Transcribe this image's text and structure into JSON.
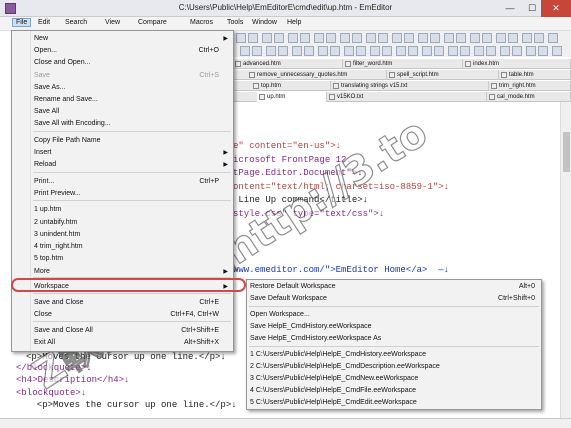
{
  "window": {
    "title": "C:\\Users\\Public\\Help\\EmEditorE\\cmd\\edit\\up.htm - EmEditor",
    "minimize_glyph": "—",
    "maximize_glyph": "☐",
    "close_glyph": "✕"
  },
  "menubar": [
    "File",
    "Edit",
    "Search",
    "View",
    "Compare",
    "Macros",
    "Tools",
    "Window",
    "Help"
  ],
  "tabs": {
    "row1": [
      "advanced.htm",
      "filter_word.htm",
      "index.htm"
    ],
    "row2": [
      "remove_unnecessary_quotes.htm",
      "spell_script.htm",
      "table.htm"
    ],
    "row3": [
      "top.htm",
      "translating strings v15.txt",
      "trim_right.htm"
    ],
    "row4": [
      "up.htm",
      "v15KO.txt",
      "cal_mode.htm"
    ]
  },
  "file_menu": {
    "items": [
      {
        "label": "New",
        "shortcut": "",
        "submenu": true,
        "disabled": false
      },
      {
        "label": "Open...",
        "shortcut": "Ctrl+O",
        "submenu": false,
        "disabled": false
      },
      {
        "label": "Close and Open...",
        "shortcut": "",
        "submenu": false,
        "disabled": false
      },
      {
        "label": "Save",
        "shortcut": "Ctrl+S",
        "submenu": false,
        "disabled": true
      },
      {
        "label": "Save As...",
        "shortcut": "",
        "submenu": false,
        "disabled": false
      },
      {
        "label": "Rename and Save...",
        "shortcut": "",
        "submenu": false,
        "disabled": false
      },
      {
        "label": "Save All",
        "shortcut": "",
        "submenu": false,
        "disabled": false
      },
      {
        "label": "Save All with Encoding...",
        "shortcut": "",
        "submenu": false,
        "disabled": false
      },
      {
        "label": "Copy File Path Name",
        "shortcut": "",
        "submenu": false,
        "disabled": false
      },
      {
        "label": "Insert",
        "shortcut": "",
        "submenu": true,
        "disabled": false
      },
      {
        "label": "Reload",
        "shortcut": "",
        "submenu": true,
        "disabled": false
      },
      {
        "label": "Print...",
        "shortcut": "Ctrl+P",
        "submenu": false,
        "disabled": false
      },
      {
        "label": "Print Preview...",
        "shortcut": "",
        "submenu": false,
        "disabled": false
      },
      {
        "label": "1 up.htm",
        "shortcut": "",
        "submenu": false,
        "disabled": false
      },
      {
        "label": "2 untabify.htm",
        "shortcut": "",
        "submenu": false,
        "disabled": false
      },
      {
        "label": "3 unindent.htm",
        "shortcut": "",
        "submenu": false,
        "disabled": false
      },
      {
        "label": "4 trim_right.htm",
        "shortcut": "",
        "submenu": false,
        "disabled": false
      },
      {
        "label": "5 top.htm",
        "shortcut": "",
        "submenu": false,
        "disabled": false
      },
      {
        "label": "More",
        "shortcut": "",
        "submenu": true,
        "disabled": false
      },
      {
        "label": "Workspace",
        "shortcut": "",
        "submenu": true,
        "disabled": false
      },
      {
        "label": "Save and Close",
        "shortcut": "Ctrl+E",
        "submenu": false,
        "disabled": false
      },
      {
        "label": "Close",
        "shortcut": "Ctrl+F4, Ctrl+W",
        "submenu": false,
        "disabled": false
      },
      {
        "label": "Save and Close All",
        "shortcut": "Ctrl+Shift+E",
        "submenu": false,
        "disabled": false
      },
      {
        "label": "Exit All",
        "shortcut": "Alt+Shift+X",
        "submenu": false,
        "disabled": false
      }
    ]
  },
  "workspace_menu": {
    "items": [
      {
        "label": "Restore Default Workspace",
        "shortcut": "Alt+0"
      },
      {
        "label": "Save Default Workspace",
        "shortcut": "Ctrl+Shift+0"
      },
      {
        "label": "Open Workspace...",
        "shortcut": ""
      },
      {
        "label": "Save HelpE_CmdHistory.eeWorkspace",
        "shortcut": ""
      },
      {
        "label": "Save HelpE_CmdHistory.eeWorkspace As",
        "shortcut": ""
      },
      {
        "label": "1 C:\\Users\\Public\\Help\\HelpE_CmdHistory.eeWorkspace",
        "shortcut": ""
      },
      {
        "label": "2 C:\\Users\\Public\\Help\\HelpE_CmdDescription.eeWorkspace",
        "shortcut": ""
      },
      {
        "label": "3 C:\\Users\\Public\\Help\\HelpE_CmdNew.eeWorkspace",
        "shortcut": ""
      },
      {
        "label": "4 C:\\Users\\Public\\Help\\HelpE_CmdFile.eeWorkspace",
        "shortcut": ""
      },
      {
        "label": "5 C:\\Users\\Public\\Help\\HelpE_CmdEdit.eeWorkspace",
        "shortcut": ""
      }
    ]
  },
  "editor": {
    "lines": [
      {
        "text": "e\" content=\"en-us\">↓",
        "color": "c-red"
      },
      {
        "text": "icrosoft FrontPage 12.",
        "color": "c-purple"
      },
      {
        "text": "tPage.Editor.Document\">↓",
        "color": "c-purple"
      },
      {
        "text": "ontent=\"text/html; charset=iso-8859-1\">↓",
        "color": "c-red"
      },
      {
        "text": " Line Up command</title>↓",
        "color": "c-black"
      },
      {
        "text": "style.css\" type=\"text/css\">↓",
        "color": "c-purple"
      },
      {
        "text": "www.emeditor.com/\">EmEditor Home</a>  —↓",
        "color": "c-blue"
      },
      {
        "text": "<p>Moves the cursor up one line.</p>↓",
        "color": "c-black"
      },
      {
        "text": "</blockquote>↓",
        "color": "c-purple"
      },
      {
        "text": "<h4>Description</h4>↓",
        "color": "c-purple"
      },
      {
        "text": "<blockquote>↓",
        "color": "c-purple"
      },
      {
        "text": "  <p>Moves the cursor up one line.</p>↓",
        "color": "c-black"
      }
    ]
  },
  "watermark": {
    "text": "Z軟體補給站http://3.to"
  },
  "colors": {
    "menu_bg": "#f2f2f2",
    "highlight_ring": "#d04a4a",
    "close_button": "#c7463a",
    "selected_menu": "#cfe0f3"
  }
}
